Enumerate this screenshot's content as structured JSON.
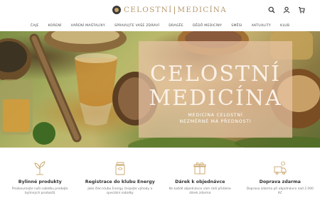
{
  "header": {
    "logo_left": "CELOSTNÍ",
    "logo_right": "MEDICÍNA",
    "icons": [
      "search-icon",
      "user-icon",
      "cart-icon"
    ]
  },
  "nav": {
    "items": [
      "ČAJE",
      "KORENÍ",
      "VAŘENÍ MAŠTALÍKY",
      "SPRAVUJTE VAŠE ZDRAVÍ",
      "DRAGĚE",
      "DĚDŮ MEDICÍNY",
      "SMĚSI",
      "AKTUALITY",
      "KLUB"
    ]
  },
  "hero": {
    "title_line1": "CELOSTNÍ",
    "title_line2": "MEDICÍNA",
    "subtitle_line1": "MEDICÍNA CELOSTNÍ",
    "subtitle_line2": "NEZMĚRNÉ MÁ PŘEDNOSTI"
  },
  "features": [
    {
      "icon": "herb-icon",
      "title": "Bylinné produkty",
      "text": "Prozkoumejte naši nabídku prodejte bylinných produktů"
    },
    {
      "icon": "jar-icon",
      "title": "Registrace do klubu Energy",
      "text": "Jako člen klubu Energy čerpejte výhody a speciální nabídky"
    },
    {
      "icon": "gift-icon",
      "title": "Dárek k objednávce",
      "text": "Ke každé objednávce vám rádi přidáme dárek zdarma"
    },
    {
      "icon": "delivery-icon",
      "title": "Doprava zdarma",
      "text": "Doprava zdarma při objednávce nad 2 000 Kč"
    }
  ],
  "colors": {
    "logo_gold": "#b79a72",
    "hero_box": "#e7c4a5"
  }
}
